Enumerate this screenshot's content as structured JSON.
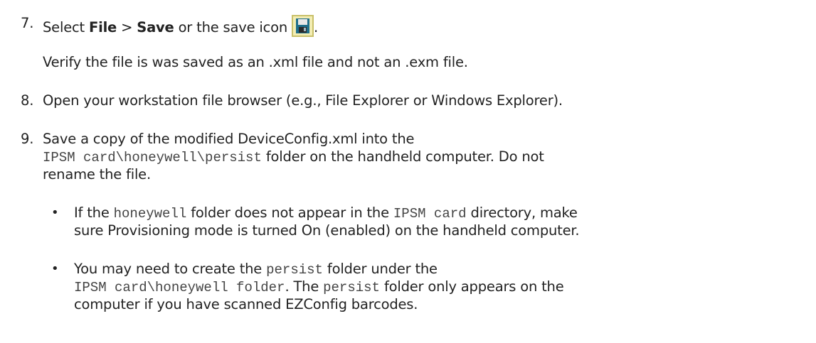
{
  "steps": [
    {
      "number": "7.",
      "line1": {
        "t1": "Select ",
        "b1": "File",
        "t2": " > ",
        "b2": "Save",
        "t3": " or the save icon",
        "t4": "."
      },
      "note": "Verify the file is was saved as an .xml file and not an .exm file."
    },
    {
      "number": "8.",
      "text": "Open your workstation file browser (e.g., File Explorer or Windows Explorer)."
    },
    {
      "number": "9.",
      "line1": "Save a copy of the modified DeviceConfig.xml into the",
      "line2": {
        "code": "IPSM card\\honeywell\\persist",
        "text": " folder on the handheld computer. Do not"
      },
      "line3": "rename the file.",
      "bullets": [
        {
          "symbol": "•",
          "l1": {
            "t1": "If the ",
            "c1": "honeywell",
            "t2": " folder does not appear in the ",
            "c2": "IPSM card",
            "t3": " directory, make"
          },
          "l2": "sure Provisioning mode is turned On (enabled) on the handheld computer."
        },
        {
          "symbol": "•",
          "l1": {
            "t1": "You may need to create the ",
            "c1": "persist",
            "t2": " folder under the"
          },
          "l2": {
            "c1": "IPSM card\\honeywell folder",
            "t1": ". The ",
            "c2": "persist",
            "t2": " folder only appears on the"
          },
          "l3": "computer if you have scanned EZConfig barcodes."
        }
      ]
    }
  ],
  "icons": {
    "save": "floppy-disk-save-icon"
  },
  "colors": {
    "text": "#222222",
    "code": "#444444",
    "icon_bg": "#f3edb3",
    "icon_border": "#c9c06a",
    "floppy": "#1f6f8b"
  }
}
